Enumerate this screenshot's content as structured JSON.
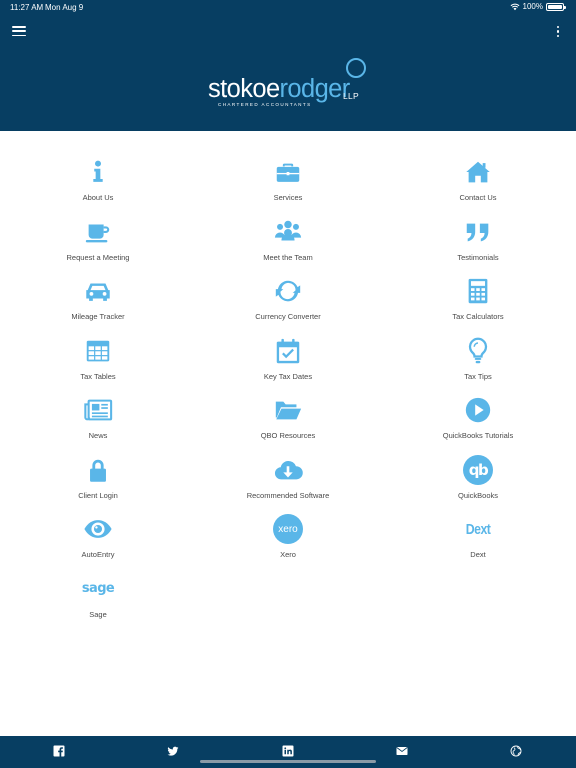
{
  "status_bar": {
    "time": "11:27 AM",
    "date": "Mon Aug 9",
    "battery": "100%"
  },
  "brand": {
    "name_part1": "stokoe",
    "name_part2": "rodger",
    "suffix": "LLP",
    "tagline": "CHARTERED ACCOUNTANTS"
  },
  "colors": {
    "header_bg": "#073e62",
    "accent": "#5ab6e8",
    "label_text": "#4a4a4a"
  },
  "grid": [
    {
      "label": "About Us",
      "icon": "info-icon"
    },
    {
      "label": "Services",
      "icon": "briefcase-icon"
    },
    {
      "label": "Contact Us",
      "icon": "home-icon"
    },
    {
      "label": "Request a Meeting",
      "icon": "coffee-cup-icon"
    },
    {
      "label": "Meet the Team",
      "icon": "team-icon"
    },
    {
      "label": "Testimonials",
      "icon": "quote-icon"
    },
    {
      "label": "Mileage Tracker",
      "icon": "car-icon"
    },
    {
      "label": "Currency Converter",
      "icon": "refresh-icon"
    },
    {
      "label": "Tax Calculators",
      "icon": "calculator-icon"
    },
    {
      "label": "Tax Tables",
      "icon": "table-icon"
    },
    {
      "label": "Key Tax Dates",
      "icon": "calendar-check-icon"
    },
    {
      "label": "Tax Tips",
      "icon": "lightbulb-icon"
    },
    {
      "label": "News",
      "icon": "newspaper-icon"
    },
    {
      "label": "QBO Resources",
      "icon": "folder-open-icon"
    },
    {
      "label": "QuickBooks Tutorials",
      "icon": "play-circle-icon"
    },
    {
      "label": "Client Login",
      "icon": "lock-icon"
    },
    {
      "label": "Recommended Software",
      "icon": "cloud-download-icon"
    },
    {
      "label": "QuickBooks",
      "icon": "quickbooks-logo-icon",
      "logo_text": "qb"
    },
    {
      "label": "AutoEntry",
      "icon": "eye-icon"
    },
    {
      "label": "Xero",
      "icon": "xero-logo-icon",
      "logo_text": "xero"
    },
    {
      "label": "Dext",
      "icon": "dext-logo-icon",
      "logo_text": "Dext"
    },
    {
      "label": "Sage",
      "icon": "sage-logo-icon",
      "logo_text": "sage"
    }
  ],
  "bottom_bar": [
    {
      "name": "facebook",
      "icon": "facebook-icon"
    },
    {
      "name": "twitter",
      "icon": "twitter-icon"
    },
    {
      "name": "linkedin",
      "icon": "linkedin-icon"
    },
    {
      "name": "email",
      "icon": "envelope-icon"
    },
    {
      "name": "website",
      "icon": "globe-icon"
    }
  ]
}
